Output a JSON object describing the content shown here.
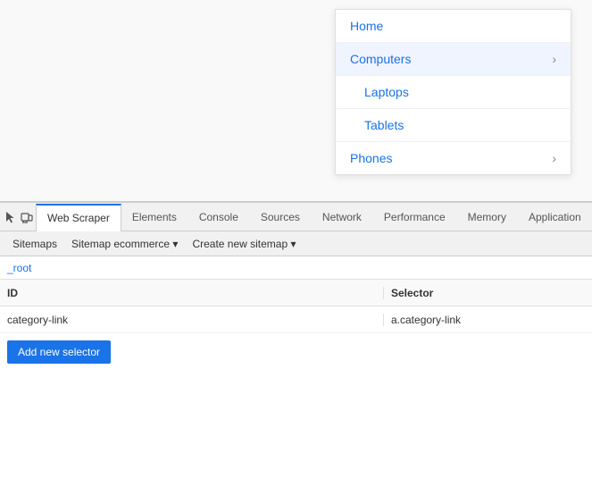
{
  "page": {
    "menu": {
      "items": [
        {
          "label": "Home",
          "indent": false,
          "hasChevron": false,
          "active": false
        },
        {
          "label": "Computers",
          "indent": false,
          "hasChevron": true,
          "active": true
        },
        {
          "label": "Laptops",
          "indent": true,
          "hasChevron": false,
          "active": false
        },
        {
          "label": "Tablets",
          "indent": true,
          "hasChevron": false,
          "active": false
        },
        {
          "label": "Phones",
          "indent": false,
          "hasChevron": true,
          "active": false
        }
      ]
    }
  },
  "devtools": {
    "tabs": [
      {
        "label": "Web Scraper",
        "active": true
      },
      {
        "label": "Elements",
        "active": false
      },
      {
        "label": "Console",
        "active": false
      },
      {
        "label": "Sources",
        "active": false
      },
      {
        "label": "Network",
        "active": false
      },
      {
        "label": "Performance",
        "active": false
      },
      {
        "label": "Memory",
        "active": false
      },
      {
        "label": "Application",
        "active": false
      }
    ],
    "toolbar": {
      "items": [
        {
          "label": "Sitemaps",
          "hasArrow": false
        },
        {
          "label": "Sitemap ecommerce",
          "hasArrow": true
        },
        {
          "label": "Create new sitemap",
          "hasArrow": true
        }
      ]
    },
    "breadcrumb": "_root",
    "table": {
      "headers": [
        {
          "label": "ID"
        },
        {
          "label": "Selector"
        }
      ],
      "rows": [
        {
          "id": "category-link",
          "selector": "a.category-link"
        }
      ]
    },
    "add_button_label": "Add new selector"
  }
}
